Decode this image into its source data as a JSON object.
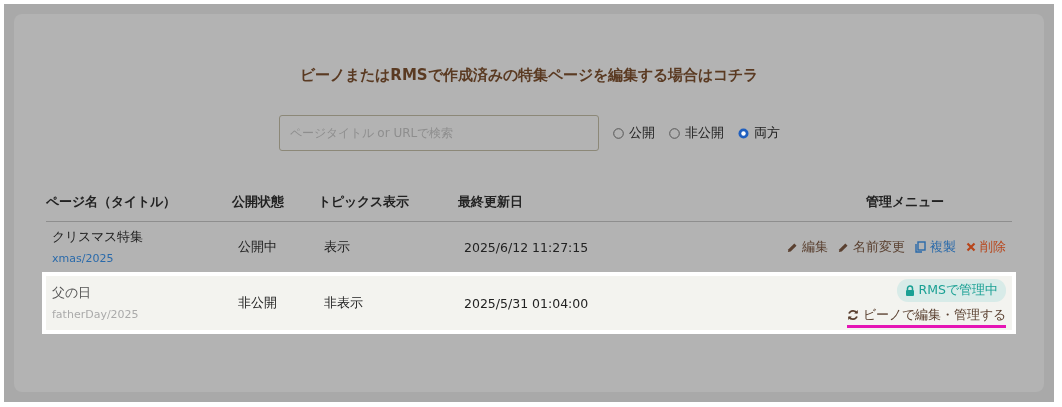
{
  "heading": "ビーノまたはRMSで作成済みの特集ページを編集する場合はコチラ",
  "search": {
    "placeholder": "ページタイトル or URLで検索"
  },
  "filters": [
    {
      "label": "公開",
      "selected": false
    },
    {
      "label": "非公開",
      "selected": false
    },
    {
      "label": "両方",
      "selected": true
    }
  ],
  "table": {
    "columns": [
      "ページ名（タイトル）",
      "公開状態",
      "トピックス表示",
      "最終更新日",
      "管理メニュー"
    ],
    "rows": [
      {
        "title": "クリスマス特集",
        "path": "xmas/2025",
        "status": "公開中",
        "topics": "表示",
        "updated": "2025/6/12 11:27:15",
        "highlighted": false,
        "actions": [
          {
            "kind": "edit",
            "label": "編集"
          },
          {
            "kind": "rename",
            "label": "名前変更"
          },
          {
            "kind": "copy",
            "label": "複製"
          },
          {
            "kind": "delete",
            "label": "削除"
          }
        ]
      },
      {
        "title": "父の日",
        "path": "fatherDay/2025",
        "status": "非公開",
        "topics": "非表示",
        "updated": "2025/5/31 01:04:00",
        "highlighted": true,
        "badge": "RMSで管理中",
        "actions": [
          {
            "kind": "convert",
            "label": "ビーノで編集・管理する"
          }
        ]
      }
    ]
  }
}
